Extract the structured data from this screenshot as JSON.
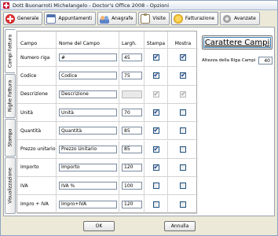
{
  "window": {
    "title": "Dott Buonarroti Michelangelo - Doctor's Office 2008 - Opzioni"
  },
  "tabs": [
    {
      "label": "Generale",
      "icon": "add-red-circle-icon"
    },
    {
      "label": "Appuntamenti",
      "icon": "calendar-icon"
    },
    {
      "label": "Anagrafe",
      "icon": "people-icon"
    },
    {
      "label": "Visite",
      "icon": "clipboard-icon"
    },
    {
      "label": "Fatturazione",
      "icon": "coin-icon",
      "active": true
    },
    {
      "label": "Avanzate",
      "icon": "gear-icon"
    }
  ],
  "side_tabs": [
    {
      "label": "Campi Fattura",
      "active": true
    },
    {
      "label": "Righe Fattura"
    },
    {
      "label": "Stampa"
    },
    {
      "label": "Visualizzazione"
    }
  ],
  "grid": {
    "headers": {
      "campo": "Campo",
      "nome": "Nome del Campo",
      "largh": "Largh.",
      "stampa": "Stampa",
      "mostra": "Mostra"
    },
    "rows": [
      {
        "campo": "Numero riga",
        "nome": "#",
        "largh": "45",
        "stampa": true,
        "mostra": true,
        "disabled": false
      },
      {
        "campo": "Codice",
        "nome": "Codice",
        "largh": "75",
        "stampa": true,
        "mostra": true,
        "disabled": false
      },
      {
        "campo": "Descrizione",
        "nome": "Descrizione",
        "largh": "",
        "stampa": true,
        "mostra": true,
        "disabled": true
      },
      {
        "campo": "Unità",
        "nome": "Unità",
        "largh": "70",
        "stampa": true,
        "mostra": false,
        "disabled": false
      },
      {
        "campo": "Quantità",
        "nome": "Quantità",
        "largh": "85",
        "stampa": true,
        "mostra": false,
        "disabled": false
      },
      {
        "campo": "Prezzo unitario",
        "nome": "Prezzo Unitario",
        "largh": "85",
        "stampa": true,
        "mostra": false,
        "disabled": false
      },
      {
        "campo": "Importo",
        "nome": "Importo",
        "largh": "120",
        "stampa": true,
        "mostra": false,
        "disabled": false
      },
      {
        "campo": "IVA",
        "nome": "IVA %",
        "largh": "100",
        "stampa": false,
        "mostra": false,
        "disabled": false
      },
      {
        "campo": "Impro + IVA",
        "nome": "Impro+IVA",
        "largh": "120",
        "stampa": false,
        "mostra": false,
        "disabled": false
      }
    ]
  },
  "right": {
    "button": "Carattere Campi",
    "height_label": "Altezza della Riga Campi",
    "height_value": "40"
  },
  "footer": {
    "ok": "OK",
    "cancel": "Annulla"
  }
}
